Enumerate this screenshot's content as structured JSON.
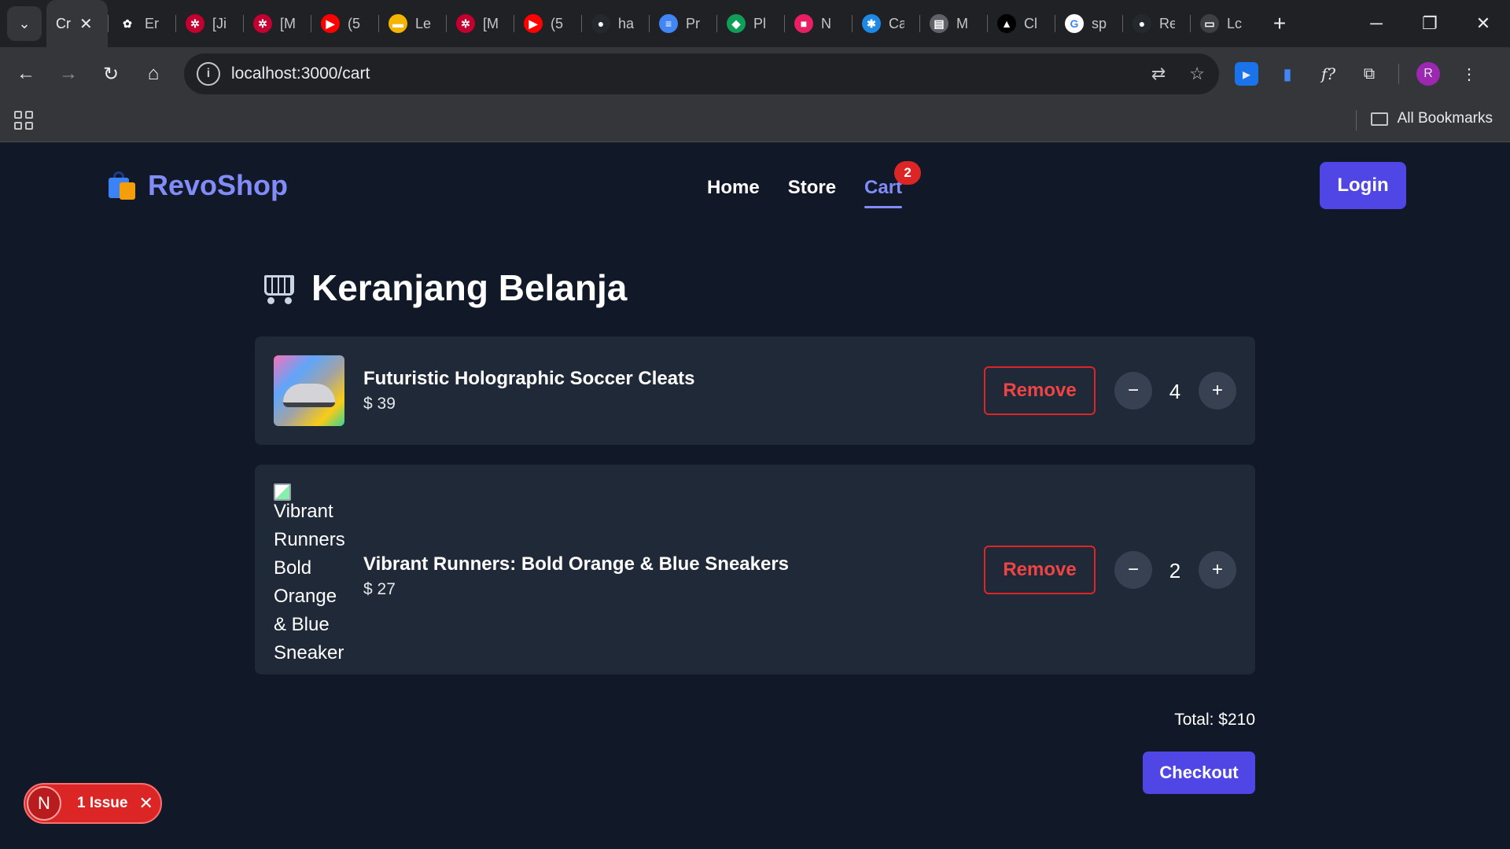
{
  "browser": {
    "active_tab": {
      "label": "Cr",
      "close": "✕"
    },
    "tabs": [
      {
        "label": "Er",
        "icon": "openai-icon",
        "color": "#202124",
        "glyph": "✿"
      },
      {
        "label": "[Ji",
        "icon": "angular-icon",
        "color": "#c3002f",
        "glyph": "✲"
      },
      {
        "label": "[M",
        "icon": "angular-icon",
        "color": "#c3002f",
        "glyph": "✲"
      },
      {
        "label": "(5",
        "icon": "youtube-icon",
        "color": "#ff0000",
        "glyph": "▶"
      },
      {
        "label": "Le",
        "icon": "slides-icon",
        "color": "#f4b400",
        "glyph": "▬"
      },
      {
        "label": "[M",
        "icon": "angular-icon",
        "color": "#c3002f",
        "glyph": "✲"
      },
      {
        "label": "(5",
        "icon": "youtube-icon",
        "color": "#ff0000",
        "glyph": "▶"
      },
      {
        "label": "ha",
        "icon": "github-icon",
        "color": "#24292e",
        "glyph": "●"
      },
      {
        "label": "Pr",
        "icon": "docs-icon",
        "color": "#4285f4",
        "glyph": "≡"
      },
      {
        "label": "Pl",
        "icon": "diamond-icon",
        "color": "#0f9d58",
        "glyph": "◆"
      },
      {
        "label": "N",
        "icon": "notion-icon",
        "color": "#e91e63",
        "glyph": "■"
      },
      {
        "label": "Ca",
        "icon": "app-icon",
        "color": "#1e88e5",
        "glyph": "✱"
      },
      {
        "label": "M",
        "icon": "doc-icon",
        "color": "#5f6368",
        "glyph": "▤"
      },
      {
        "label": "Cl",
        "icon": "vercel-icon",
        "color": "#000000",
        "glyph": "▲"
      },
      {
        "label": "sp",
        "icon": "google-icon",
        "color": "#ffffff",
        "glyph": "G"
      },
      {
        "label": "Re",
        "icon": "github-icon",
        "color": "#24292e",
        "glyph": "●"
      },
      {
        "label": "Lc",
        "icon": "page-icon",
        "color": "#3c4043",
        "glyph": "▭"
      }
    ],
    "url": "localhost:3000/cart",
    "all_bookmarks": "All Bookmarks",
    "profile_initial": "R"
  },
  "site": {
    "brand": "RevoShop",
    "nav": {
      "home": "Home",
      "store": "Store",
      "cart": "Cart",
      "cart_count": "2"
    },
    "login": "Login"
  },
  "cart": {
    "title": "Keranjang Belanja",
    "items": [
      {
        "name": "Futuristic Holographic Soccer Cleats",
        "price": "$ 39",
        "quantity": "4",
        "remove": "Remove",
        "minus": "−",
        "plus": "+"
      },
      {
        "name": "Vibrant Runners: Bold Orange & Blue Sneakers",
        "price": "$ 27",
        "quantity": "2",
        "remove": "Remove",
        "minus": "−",
        "plus": "+",
        "image_alt": "Vibrant Runners Bold Orange & Blue Sneaker"
      }
    ],
    "total": "Total: $210",
    "checkout": "Checkout"
  },
  "devtools": {
    "initial": "N",
    "issues": "1 Issue",
    "close": "✕"
  }
}
